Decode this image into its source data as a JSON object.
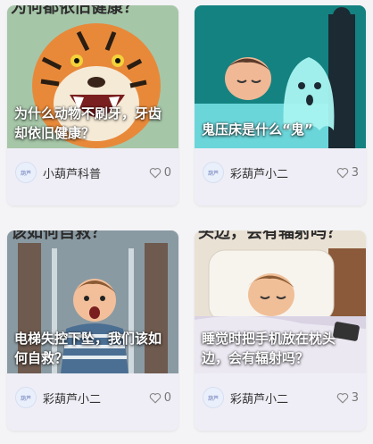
{
  "cards": [
    {
      "title": "为什么动物不刷牙，牙齿却依旧健康？",
      "image_caption": "为何都依旧健康？",
      "author": "小葫芦科普",
      "avatar_text": "葫芦",
      "likes": "0"
    },
    {
      "title": "鬼压床是什么“鬼”",
      "author": "彩葫芦小二",
      "avatar_text": "葫芦",
      "likes": "3"
    },
    {
      "title": "电梯失控下坠，我们该如何自救？",
      "image_caption": "该如何自救？",
      "author": "彩葫芦小二",
      "avatar_text": "葫芦",
      "likes": "0"
    },
    {
      "title": "睡觉时把手机放在枕头边，会有辐射吗？",
      "image_caption": "头边，会有辐射吗？",
      "author": "彩葫芦小二",
      "avatar_text": "葫芦",
      "likes": "3"
    }
  ],
  "colors": {
    "card_meta_bg": "#efeef6",
    "page_bg": "#f4f4f6"
  },
  "icons": {
    "like": "heart-outline-icon"
  }
}
